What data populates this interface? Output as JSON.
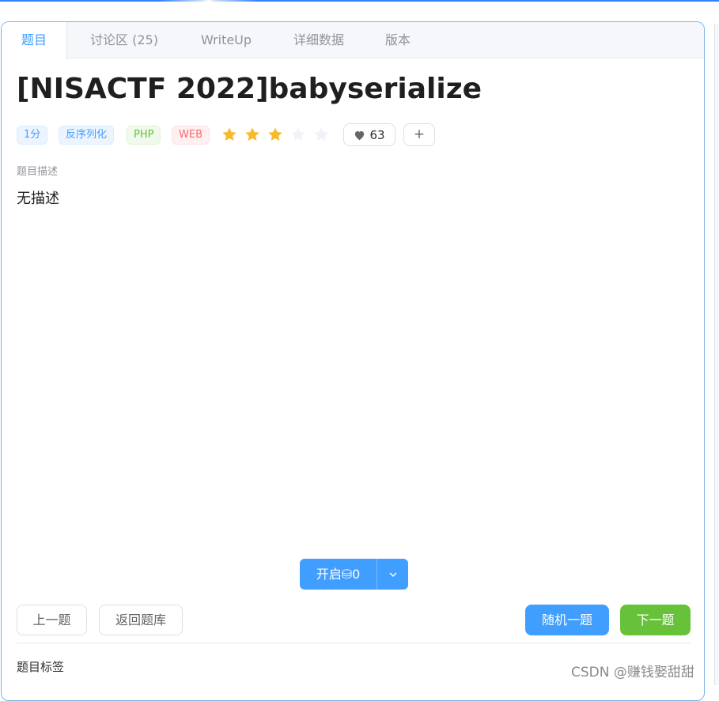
{
  "tabs": [
    {
      "label": "题目"
    },
    {
      "label": "讨论区 (25)"
    },
    {
      "label": "WriteUp"
    },
    {
      "label": "详细数据"
    },
    {
      "label": "版本"
    }
  ],
  "problem": {
    "title": "[NISACTF 2022]babyserialize",
    "tags": [
      "1分",
      "反序列化",
      "PHP",
      "WEB"
    ],
    "rating": {
      "filled": 3,
      "total": 5
    },
    "likes": "63",
    "add_label": "+",
    "description_label": "题目描述",
    "description": "无描述"
  },
  "actions": {
    "start_label": "开启⛁0",
    "prev_label": "上一题",
    "back_label": "返回题库",
    "random_label": "随机一题",
    "next_label": "下一题"
  },
  "footer": {
    "tags_label": "题目标签"
  },
  "watermark": "CSDN @赚钱娶甜甜",
  "colors": {
    "primary": "#409eff",
    "success": "#67c23a",
    "danger": "#f56c6c",
    "star": "#f7ba2a",
    "star_empty": "#eff2f7"
  }
}
